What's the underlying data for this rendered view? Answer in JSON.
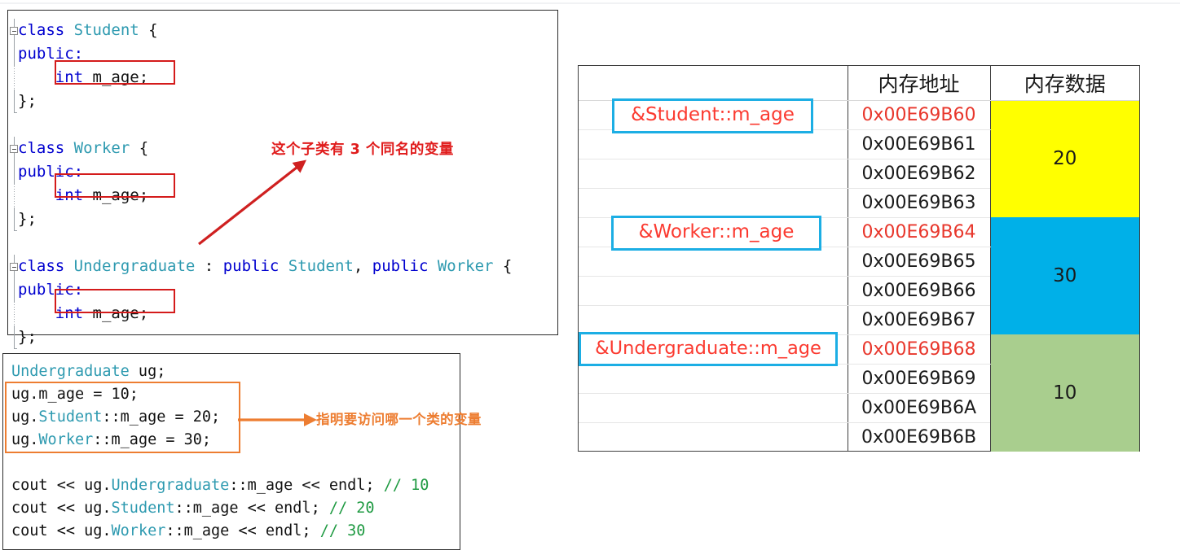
{
  "code_classes": {
    "lines": [
      {
        "fold": true,
        "rail": "solid",
        "tokens": [
          {
            "t": "class ",
            "c": "kw"
          },
          {
            "t": "Student",
            "c": "type"
          },
          {
            "t": " {",
            "c": "plain"
          }
        ]
      },
      {
        "fold": false,
        "rail": "solid",
        "tokens": [
          {
            "t": "public:",
            "c": "kw"
          }
        ]
      },
      {
        "fold": false,
        "rail": "dotted",
        "tokens": [
          {
            "t": "    ",
            "c": "plain"
          },
          {
            "t": "int",
            "c": "kw"
          },
          {
            "t": " m_age;",
            "c": "plain"
          }
        ]
      },
      {
        "fold": false,
        "rail": "solid-end",
        "tokens": [
          {
            "t": "};",
            "c": "plain"
          }
        ]
      },
      {
        "fold": false,
        "rail": "none",
        "tokens": [
          {
            "t": " ",
            "c": "plain"
          }
        ]
      },
      {
        "fold": true,
        "rail": "solid",
        "tokens": [
          {
            "t": "class ",
            "c": "kw"
          },
          {
            "t": "Worker",
            "c": "type"
          },
          {
            "t": " {",
            "c": "plain"
          }
        ]
      },
      {
        "fold": false,
        "rail": "solid",
        "tokens": [
          {
            "t": "public:",
            "c": "kw"
          }
        ]
      },
      {
        "fold": false,
        "rail": "dotted",
        "tokens": [
          {
            "t": "    ",
            "c": "plain"
          },
          {
            "t": "int",
            "c": "kw"
          },
          {
            "t": " m_age;",
            "c": "plain"
          }
        ]
      },
      {
        "fold": false,
        "rail": "solid-end",
        "tokens": [
          {
            "t": "};",
            "c": "plain"
          }
        ]
      },
      {
        "fold": false,
        "rail": "none",
        "tokens": [
          {
            "t": " ",
            "c": "plain"
          }
        ]
      },
      {
        "fold": true,
        "rail": "solid",
        "tokens": [
          {
            "t": "class ",
            "c": "kw"
          },
          {
            "t": "Undergraduate",
            "c": "type"
          },
          {
            "t": " : ",
            "c": "plain"
          },
          {
            "t": "public",
            "c": "kw"
          },
          {
            "t": " ",
            "c": "plain"
          },
          {
            "t": "Student",
            "c": "type"
          },
          {
            "t": ", ",
            "c": "plain"
          },
          {
            "t": "public",
            "c": "kw"
          },
          {
            "t": " ",
            "c": "plain"
          },
          {
            "t": "Worker",
            "c": "type"
          },
          {
            "t": " {",
            "c": "plain"
          }
        ]
      },
      {
        "fold": false,
        "rail": "solid",
        "tokens": [
          {
            "t": "public:",
            "c": "kw"
          }
        ]
      },
      {
        "fold": false,
        "rail": "dotted",
        "tokens": [
          {
            "t": "    ",
            "c": "plain"
          },
          {
            "t": "int",
            "c": "kw"
          },
          {
            "t": " m_age;",
            "c": "plain"
          }
        ]
      },
      {
        "fold": false,
        "rail": "solid-end",
        "tokens": [
          {
            "t": "};",
            "c": "plain"
          }
        ]
      }
    ]
  },
  "code_usage": {
    "lines": [
      {
        "tokens": [
          {
            "t": "Undergraduate",
            "c": "type"
          },
          {
            "t": " ug;",
            "c": "plain"
          }
        ]
      },
      {
        "tokens": [
          {
            "t": "ug.m_age = 10;",
            "c": "plain"
          }
        ]
      },
      {
        "tokens": [
          {
            "t": "ug.",
            "c": "plain"
          },
          {
            "t": "Student",
            "c": "type"
          },
          {
            "t": "::m_age = 20;",
            "c": "plain"
          }
        ]
      },
      {
        "tokens": [
          {
            "t": "ug.",
            "c": "plain"
          },
          {
            "t": "Worker",
            "c": "type"
          },
          {
            "t": "::m_age = 30;",
            "c": "plain"
          }
        ]
      },
      {
        "tokens": [
          {
            "t": " ",
            "c": "plain"
          }
        ]
      },
      {
        "tokens": [
          {
            "t": "cout << ug.",
            "c": "plain"
          },
          {
            "t": "Undergraduate",
            "c": "type"
          },
          {
            "t": "::m_age << endl; ",
            "c": "plain"
          },
          {
            "t": "// 10",
            "c": "cmt"
          }
        ]
      },
      {
        "tokens": [
          {
            "t": "cout << ug.",
            "c": "plain"
          },
          {
            "t": "Student",
            "c": "type"
          },
          {
            "t": "::m_age << endl; ",
            "c": "plain"
          },
          {
            "t": "// 20",
            "c": "cmt"
          }
        ]
      },
      {
        "tokens": [
          {
            "t": "cout << ug.",
            "c": "plain"
          },
          {
            "t": "Worker",
            "c": "type"
          },
          {
            "t": "::m_age << endl; ",
            "c": "plain"
          },
          {
            "t": "// 30",
            "c": "cmt"
          }
        ]
      }
    ]
  },
  "annotations": {
    "classes_note": "这个子类有 3 个同名的变量",
    "usage_note": "指明要访问哪一个类的变量",
    "classes_note_color": "#e01c1c",
    "usage_note_color": "#ed7d31"
  },
  "memory_table": {
    "headers": {
      "label": "",
      "address": "内存地址",
      "data": "内存数据"
    },
    "chips": [
      {
        "id": "chip-student",
        "text": "&Student::m_age"
      },
      {
        "id": "chip-worker",
        "text": "&Worker::m_age"
      },
      {
        "id": "chip-under",
        "text": "&Undergraduate::m_age"
      }
    ],
    "rows": [
      {
        "address": "0x00E69B60",
        "highlight": true
      },
      {
        "address": "0x00E69B61",
        "highlight": false
      },
      {
        "address": "0x00E69B62",
        "highlight": false
      },
      {
        "address": "0x00E69B63",
        "highlight": false
      },
      {
        "address": "0x00E69B64",
        "highlight": true
      },
      {
        "address": "0x00E69B65",
        "highlight": false
      },
      {
        "address": "0x00E69B66",
        "highlight": false
      },
      {
        "address": "0x00E69B67",
        "highlight": false
      },
      {
        "address": "0x00E69B68",
        "highlight": true
      },
      {
        "address": "0x00E69B69",
        "highlight": false
      },
      {
        "address": "0x00E69B6A",
        "highlight": false
      },
      {
        "address": "0x00E69B6B",
        "highlight": false
      }
    ],
    "blocks": [
      {
        "value": "20",
        "color": "#ffff00",
        "span": 4
      },
      {
        "value": "30",
        "color": "#00b0e8",
        "span": 4
      },
      {
        "value": "10",
        "color": "#a9ce8e",
        "span": 4
      }
    ]
  },
  "palette": {
    "red_box": "#d41b1b",
    "orange_box": "#ed7d31",
    "blue_chip": "#1caee4",
    "address_highlight": "#e8372c"
  }
}
